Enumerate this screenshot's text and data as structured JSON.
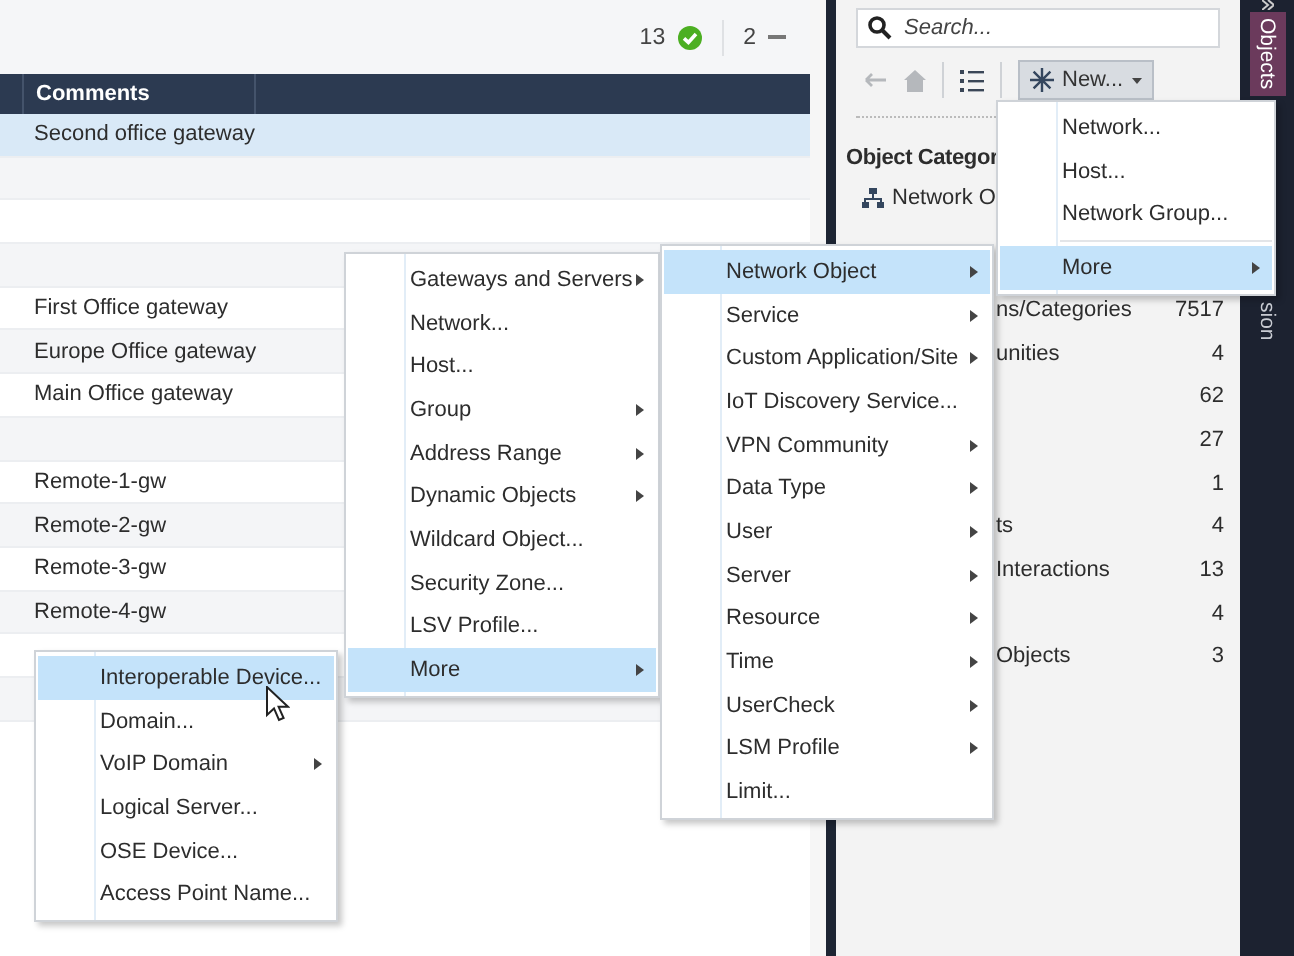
{
  "status": {
    "passed": "13",
    "warnings": "2"
  },
  "table": {
    "columns": [
      "Comments"
    ],
    "rows": [
      {
        "comments": "Second office gateway",
        "selected": true
      },
      {
        "selected": false
      },
      {
        "selected": false
      },
      {
        "selected": false
      },
      {
        "comments": "First Office gateway",
        "selected": false
      },
      {
        "comments": "Europe Office gateway",
        "selected": false
      },
      {
        "comments": "Main Office gateway",
        "selected": false
      },
      {
        "selected": false
      },
      {
        "comments": "Remote-1-gw",
        "selected": false
      },
      {
        "comments": "Remote-2-gw",
        "selected": false
      },
      {
        "comments": "Remote-3-gw",
        "selected": false
      },
      {
        "comments": "Remote-4-gw",
        "selected": false
      },
      {
        "selected": false
      },
      {
        "selected": false
      }
    ]
  },
  "search": {
    "placeholder": "Search..."
  },
  "toolbar": {
    "back": {
      "disabled": true
    },
    "home": {
      "disabled": true
    },
    "new_button": {
      "label": "New...",
      "pressed": true
    }
  },
  "categories": {
    "title": "Object Categor",
    "first": "Network O",
    "items": [
      {
        "label": "ns/Categories",
        "count": "7517"
      },
      {
        "label": "unities",
        "count": "4"
      },
      {
        "count": "62"
      },
      {
        "count": "27"
      },
      {
        "count": "1"
      },
      {
        "label": "ts",
        "count": "4"
      },
      {
        "label": "Interactions",
        "count": "13"
      },
      {
        "count": "4"
      },
      {
        "label": "Objects",
        "count": "3"
      }
    ]
  },
  "side_tabs": [
    {
      "label": "Objects",
      "selected": true
    },
    {
      "label": "sion",
      "selected": false
    }
  ],
  "menus": [
    {
      "items": [
        {
          "kind": "item",
          "label": "Interoperable Device...",
          "submenu": false,
          "selected": true
        },
        {
          "kind": "item",
          "label": "Domain...",
          "submenu": false,
          "selected": false
        },
        {
          "kind": "item",
          "label": "VoIP Domain",
          "submenu": true,
          "selected": false
        },
        {
          "kind": "item",
          "label": "Logical Server...",
          "submenu": false,
          "selected": false
        },
        {
          "kind": "item",
          "label": "OSE Device...",
          "submenu": false,
          "selected": false
        },
        {
          "kind": "item",
          "label": "Access Point Name...",
          "submenu": false,
          "selected": false
        }
      ]
    },
    {
      "items": [
        {
          "kind": "item",
          "label": "Gateways and Servers",
          "submenu": true,
          "selected": false
        },
        {
          "kind": "item",
          "label": "Network...",
          "submenu": false,
          "selected": false
        },
        {
          "kind": "item",
          "label": "Host...",
          "submenu": false,
          "selected": false
        },
        {
          "kind": "item",
          "label": "Group",
          "submenu": true,
          "selected": false
        },
        {
          "kind": "item",
          "label": "Address Range",
          "submenu": true,
          "selected": false
        },
        {
          "kind": "item",
          "label": "Dynamic Objects",
          "submenu": true,
          "selected": false
        },
        {
          "kind": "item",
          "label": "Wildcard Object...",
          "submenu": false,
          "selected": false
        },
        {
          "kind": "item",
          "label": "Security Zone...",
          "submenu": false,
          "selected": false
        },
        {
          "kind": "item",
          "label": "LSV Profile...",
          "submenu": false,
          "selected": false
        },
        {
          "kind": "item",
          "label": "More",
          "submenu": true,
          "selected": true
        }
      ]
    },
    {
      "items": [
        {
          "kind": "item",
          "label": "Network Object",
          "submenu": true,
          "selected": true
        },
        {
          "kind": "item",
          "label": "Service",
          "submenu": true,
          "selected": false
        },
        {
          "kind": "item",
          "label": "Custom Application/Site",
          "submenu": true,
          "selected": false
        },
        {
          "kind": "item",
          "label": "IoT Discovery Service...",
          "submenu": false,
          "selected": false
        },
        {
          "kind": "item",
          "label": "VPN Community",
          "submenu": true,
          "selected": false
        },
        {
          "kind": "item",
          "label": "Data Type",
          "submenu": true,
          "selected": false
        },
        {
          "kind": "item",
          "label": "User",
          "submenu": true,
          "selected": false
        },
        {
          "kind": "item",
          "label": "Server",
          "submenu": true,
          "selected": false
        },
        {
          "kind": "item",
          "label": "Resource",
          "submenu": true,
          "selected": false
        },
        {
          "kind": "item",
          "label": "Time",
          "submenu": true,
          "selected": false
        },
        {
          "kind": "item",
          "label": "UserCheck",
          "submenu": true,
          "selected": false
        },
        {
          "kind": "item",
          "label": "LSM Profile",
          "submenu": true,
          "selected": false
        },
        {
          "kind": "item",
          "label": "Limit...",
          "submenu": false,
          "selected": false
        }
      ]
    },
    {
      "items": [
        {
          "kind": "item",
          "label": "Network...",
          "submenu": false,
          "selected": false
        },
        {
          "kind": "item",
          "label": "Host...",
          "submenu": false,
          "selected": false
        },
        {
          "kind": "item",
          "label": "Network Group...",
          "submenu": false,
          "selected": false
        },
        {
          "kind": "separator"
        },
        {
          "kind": "item",
          "label": "More",
          "submenu": true,
          "selected": true
        }
      ]
    }
  ]
}
